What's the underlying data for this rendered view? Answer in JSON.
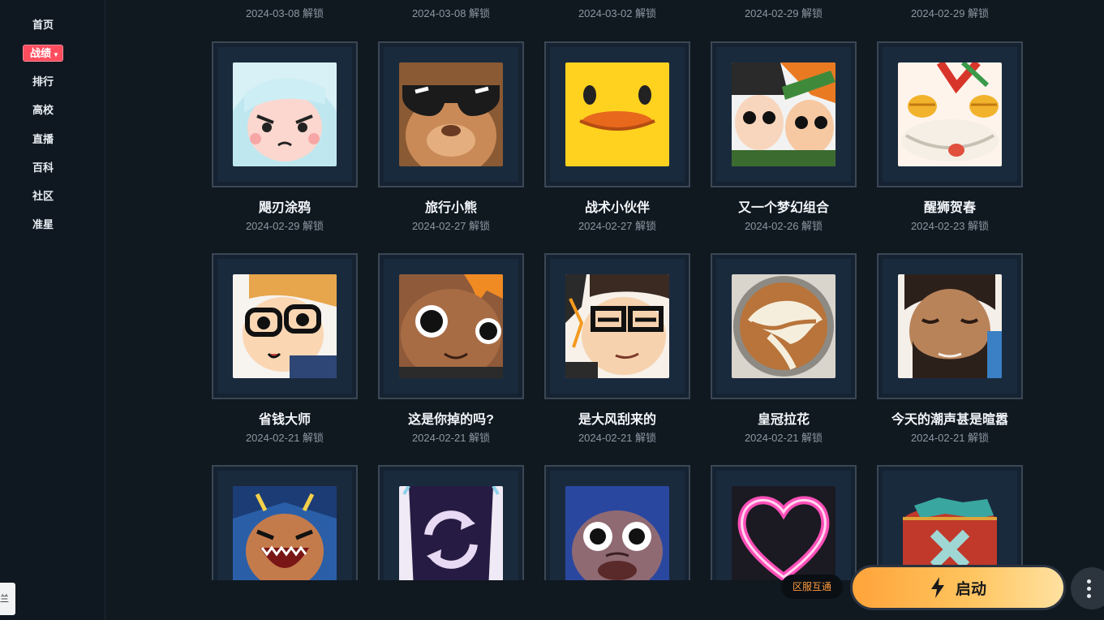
{
  "sidebar": {
    "items": [
      {
        "label": "首页"
      },
      {
        "label": "战绩",
        "active": true
      },
      {
        "label": "排行"
      },
      {
        "label": "高校"
      },
      {
        "label": "直播"
      },
      {
        "label": "百科"
      },
      {
        "label": "社区"
      },
      {
        "label": "准星"
      }
    ],
    "edge_tab": "兰"
  },
  "top_row_dates": [
    "2024-03-08 解锁",
    "2024-03-08 解锁",
    "2024-03-02 解锁",
    "2024-02-29 解锁",
    "2024-02-29 解锁"
  ],
  "sprays": [
    {
      "name": "飓刃涂鸦",
      "date": "2024-02-29 解锁",
      "icon": "white-hair-girl-icon"
    },
    {
      "name": "旅行小熊",
      "date": "2024-02-27 解锁",
      "icon": "bear-sunglasses-icon"
    },
    {
      "name": "战术小伙伴",
      "date": "2024-02-27 解锁",
      "icon": "yellow-duck-icon"
    },
    {
      "name": "又一个梦幻组合",
      "date": "2024-02-26 解锁",
      "icon": "duo-characters-icon"
    },
    {
      "name": "醒狮贺春",
      "date": "2024-02-23 解锁",
      "icon": "lion-dance-icon"
    },
    {
      "name": "省钱大师",
      "date": "2024-02-21 解锁",
      "icon": "glasses-boy-icon"
    },
    {
      "name": "这是你掉的吗?",
      "date": "2024-02-21 解锁",
      "icon": "surprised-girl-icon"
    },
    {
      "name": "是大风刮来的",
      "date": "2024-02-21 解锁",
      "icon": "smug-glasses-icon"
    },
    {
      "name": "皇冠拉花",
      "date": "2024-02-21 解锁",
      "icon": "latte-art-icon"
    },
    {
      "name": "今天的潮声甚是暄嚣",
      "date": "2024-02-21 解锁",
      "icon": "bearded-man-icon"
    },
    {
      "name": "",
      "date": "",
      "icon": "shouting-hero-icon"
    },
    {
      "name": "",
      "date": "",
      "icon": "reload-arrows-icon"
    },
    {
      "name": "",
      "date": "",
      "icon": "scared-face-icon"
    },
    {
      "name": "",
      "date": "",
      "icon": "neon-heart-icon"
    },
    {
      "name": "",
      "date": "",
      "icon": "broken-badge-icon"
    }
  ],
  "footer": {
    "region_badge": "区服互通",
    "start_label": "启动"
  },
  "colors": {
    "background": "#101820",
    "active_nav": "#ff4d5e",
    "start_gradient_start": "#ffa33a",
    "start_gradient_end": "#ffe1a0",
    "badge_text": "#ff9a3c"
  }
}
